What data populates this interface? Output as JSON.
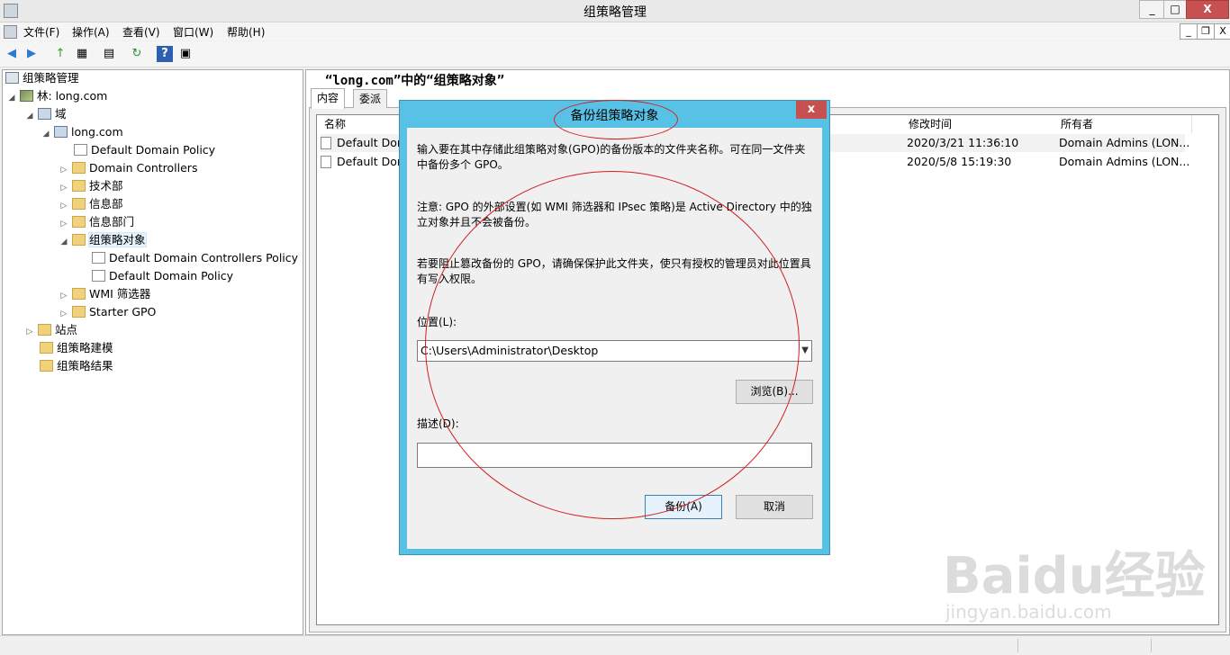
{
  "window": {
    "title": "组策略管理",
    "minimize": "_",
    "maximize": "□",
    "close": "X"
  },
  "menu": [
    "文件(F)",
    "操作(A)",
    "查看(V)",
    "窗口(W)",
    "帮助(H)"
  ],
  "mdi": {
    "minimize": "_",
    "restore": "❐",
    "close": "X"
  },
  "toolbar": {
    "back": "◀",
    "forward": "▶",
    "up": "↑",
    "show_hide": "▦",
    "properties": "▤",
    "refresh": "↻",
    "help": "?",
    "console": "▣"
  },
  "tree": {
    "root": "组策略管理",
    "forest": "林: long.com",
    "domains": "域",
    "domain": "long.com",
    "default_domain_policy": "Default Domain Policy",
    "domain_controllers": "Domain Controllers",
    "ou1": "技术部",
    "ou2": "信息部",
    "ou3": "信息部门",
    "gpo_container": "组策略对象",
    "gpo1": "Default Domain Controllers Policy",
    "gpo2": "Default Domain Policy",
    "wmi": "WMI 筛选器",
    "starter": "Starter GPO",
    "sites": "站点",
    "modeling": "组策略建模",
    "results": "组策略结果"
  },
  "right": {
    "title": "“long.com”中的“组策略对象”",
    "tabs": [
      "内容",
      "委派"
    ],
    "columns": {
      "name": "名称",
      "modified": "修改时间",
      "owner": "所有者"
    },
    "rows": [
      {
        "name": "Default Don",
        "modified": "2020/3/21 11:36:10",
        "owner": "Domain Admins (LON..."
      },
      {
        "name": "Default Don",
        "modified": "2020/5/8 15:19:30",
        "owner": "Domain Admins (LON..."
      }
    ]
  },
  "dialog": {
    "title": "备份组策略对象",
    "close": "x",
    "para1": "输入要在其中存储此组策略对象(GPO)的备份版本的文件夹名称。可在同一文件夹中备份多个 GPO。",
    "para2": "注意: GPO 的外部设置(如 WMI 筛选器和 IPsec 策略)是 Active Directory 中的独立对象并且不会被备份。",
    "para3": "若要阻止篡改备份的 GPO，请确保保护此文件夹，使只有授权的管理员对此位置具有写入权限。",
    "location_label": "位置(L):",
    "location_value": "C:\\Users\\Administrator\\Desktop",
    "browse": "浏览(B)...",
    "description_label": "描述(D):",
    "description_value": "",
    "backup": "备份(A)",
    "cancel": "取消"
  },
  "watermark": {
    "brand": "Baidu经验",
    "url": "jingyan.baidu.com"
  },
  "colors": {
    "dialog_frame": "#58c2e6",
    "close_red": "#c75050",
    "annotation": "#d02020"
  }
}
